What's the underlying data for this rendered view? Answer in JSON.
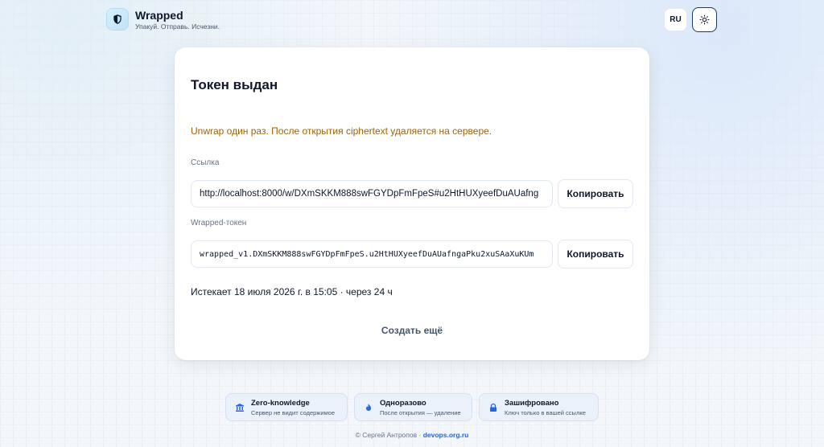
{
  "app": {
    "name": "Wrapped",
    "tagline": "Упакуй. Отправь. Исчезни."
  },
  "header": {
    "lang_label": "RU",
    "theme_icon": "sun-icon"
  },
  "card": {
    "title": "Токен выдан",
    "notice": "Unwrap один раз. После открытия ciphertext удаляется на сервере.",
    "link": {
      "label": "Ссылка",
      "value": "http://localhost:8000/w/DXmSKKM888swFGYDpFmFpeS#u2HtHUXyeefDuAUafng",
      "copy_label": "Копировать"
    },
    "token": {
      "label": "Wrapped-токен",
      "value": "wrapped_v1.DXmSKKM888swFGYDpFmFpeS.u2HtHUXyeefDuAUafngaPku2xuSAaXuKUm",
      "copy_label": "Копировать"
    },
    "expires": "Истекает 18 июля 2026 г. в 15:05 · через 24 ч",
    "create_more": "Создать ещё"
  },
  "features": [
    {
      "icon": "bank-icon",
      "title": "Zero-knowledge",
      "desc": "Сервер не видит содержимое"
    },
    {
      "icon": "flame-icon",
      "title": "Одноразово",
      "desc": "После открытия — удаление"
    },
    {
      "icon": "lock-icon",
      "title": "Зашифровано",
      "desc": "Ключ только в вашей ссылке"
    }
  ],
  "footer": {
    "copyright": "© Сергей Антропов ·",
    "link": "devops.org.ru"
  },
  "colors": {
    "notice": "#a16207",
    "accent": "#2563eb",
    "feature_bg": "#eaf1fb"
  }
}
